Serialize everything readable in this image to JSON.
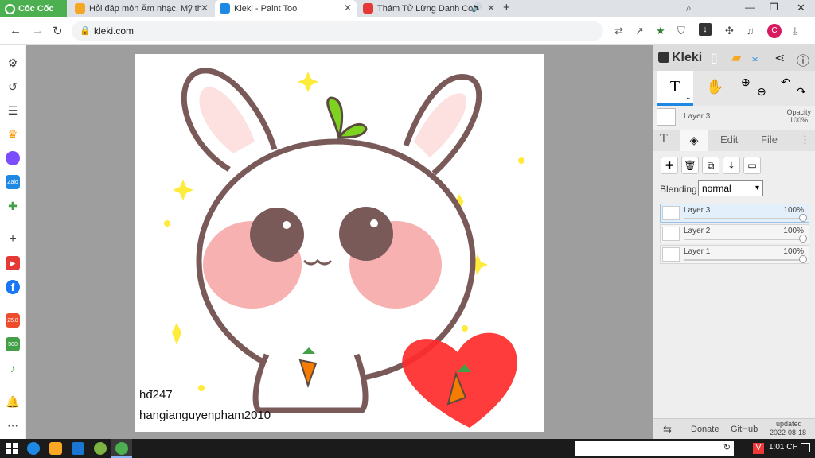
{
  "browser": {
    "brand": "Cốc Cốc",
    "tabs": [
      {
        "title": "Hỏi đáp môn Âm nhạc, Mỹ th",
        "active": false
      },
      {
        "title": "Kleki - Paint Tool",
        "active": true
      },
      {
        "title": "Thám Tử Lừng Danh Con",
        "active": false
      }
    ],
    "url": "kleki.com",
    "profile_initial": "C"
  },
  "canvas": {
    "signature_line1": "hđ247",
    "signature_line2": "hangianguyenpham2010"
  },
  "panel": {
    "brand": "Kleki",
    "layer_name": "Layer 3",
    "opacity_label": "Opacity",
    "opacity_value": "100%",
    "tabs": {
      "edit": "Edit",
      "file": "File"
    },
    "blending_label": "Blending",
    "blending_value": "normal",
    "layers": [
      {
        "name": "Layer 3",
        "opacity": "100%",
        "selected": true
      },
      {
        "name": "Layer 2",
        "opacity": "100%",
        "selected": false
      },
      {
        "name": "Layer 1",
        "opacity": "100%",
        "selected": false
      }
    ],
    "footer": {
      "donate": "Donate",
      "github": "GitHub",
      "updated_label": "updated",
      "updated_date": "2022-08-18"
    }
  },
  "taskbar": {
    "clock": "1:01 CH"
  },
  "colors": {
    "accent_green": "#4caf50",
    "kleki_blue": "#1e88e5"
  }
}
